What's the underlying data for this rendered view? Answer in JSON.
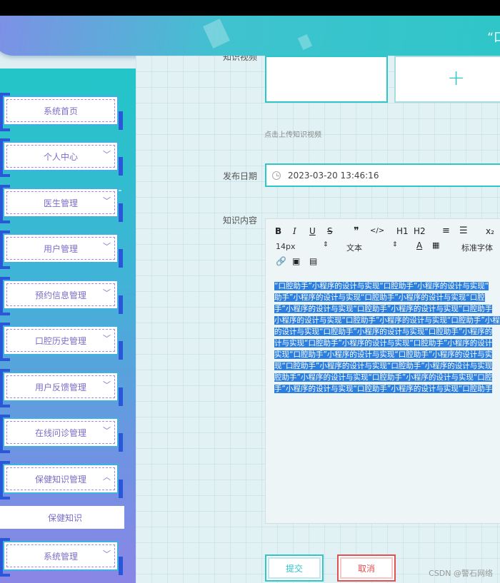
{
  "header": {
    "title": "“口"
  },
  "sidebar": {
    "items": [
      {
        "label": "系统首页",
        "chevron": ""
      },
      {
        "label": "个人中心",
        "chevron": "﹀"
      },
      {
        "label": "医生管理",
        "chevron": "﹀"
      },
      {
        "label": "用户管理",
        "chevron": "﹀"
      },
      {
        "label": "预约信息管理",
        "chevron": "﹀"
      },
      {
        "label": "口腔历史管理",
        "chevron": "﹀"
      },
      {
        "label": "用户反馈管理",
        "chevron": "﹀"
      },
      {
        "label": "在线问诊管理",
        "chevron": "﹀"
      },
      {
        "label": "保健知识管理",
        "chevron": "︿"
      },
      {
        "label": "系统管理",
        "chevron": "﹀"
      }
    ],
    "sub_item": "保健知识"
  },
  "form": {
    "video_label": "知识视频",
    "upload_plus": "+",
    "upload_hint": "点击上传知识视频",
    "date_label": "发布日期",
    "date_value": "2023-03-20 13:46:16",
    "content_label": "知识内容"
  },
  "editor": {
    "toolbar": {
      "bold": "B",
      "italic": "I",
      "underline": "U",
      "strike": "S",
      "quote": "❞",
      "code": "</>",
      "h1": "H1",
      "h2": "H2",
      "ordered_list": "≡",
      "bullet_list": "☰",
      "subscript": "x₂",
      "font_size": "14px",
      "text_type": "文本",
      "font_family": "标准字体"
    },
    "lines": [
      "“口腔助手”小程序的设计与实现“口腔助手”小程序的设计与实现“",
      "助手”小程序的设计与实现“口腔助手”小程序的设计与实现“口腔",
      "手”小程序的设计与实现“口腔助手”小程序的设计与实现“口腔助手",
      "小程序的设计与实现“口腔助手”小程序的设计与实现“口腔助手”小程",
      "的设计与实现“口腔助手”小程序的设计与实现“口腔助手”小程序的",
      "计与实现“口腔助手”小程序的设计与实现“口腔助手”小程序的设计",
      "实现“口腔助手”小程序的设计与实现“口腔助手”小程序的设计与实",
      "现“口腔助手”小程序的设计与实现“口腔助手”小程序的设计与实现",
      "腔助手”小程序的设计与实现“口腔助手”小程序的设计与实现“口腔",
      "手”小程序的设计与实现“口腔助手”小程序的设计与实现“口腔助手"
    ]
  },
  "buttons": {
    "submit": "提交",
    "cancel": "取消"
  },
  "watermark": "CSDN @警石网络"
}
